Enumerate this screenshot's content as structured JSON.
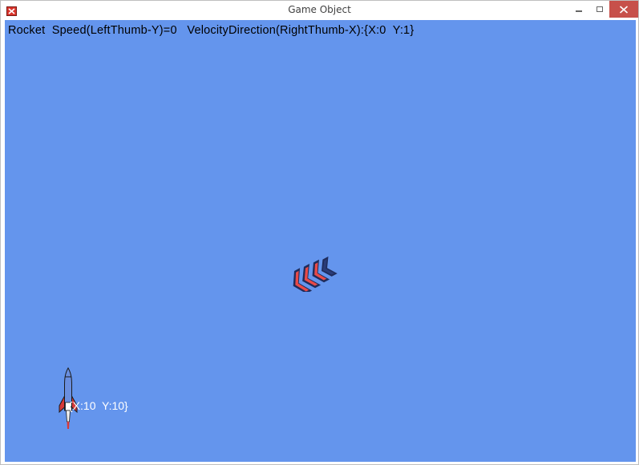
{
  "window": {
    "title": "Game Object",
    "icons": {
      "app": "app-icon",
      "minimize": "minimize-icon",
      "maximize": "maximize-icon",
      "close": "close-icon"
    }
  },
  "game": {
    "background_color": "#6495ed",
    "hud_text": "Rocket  Speed(LeftThumb-Y)=0   VelocityDirection(RightThumb-X):{X:0  Y:1}",
    "rocket_position_label": "{X:10  Y:10}",
    "sprites": {
      "direction": "chevron-arrows-sprite",
      "player": "rocket-sprite"
    },
    "colors": {
      "chevron_red": "#e84a48",
      "chevron_navy": "#1f2c5c",
      "rocket_body": "#6a8fe0",
      "rocket_fin": "#d63a3a"
    }
  }
}
